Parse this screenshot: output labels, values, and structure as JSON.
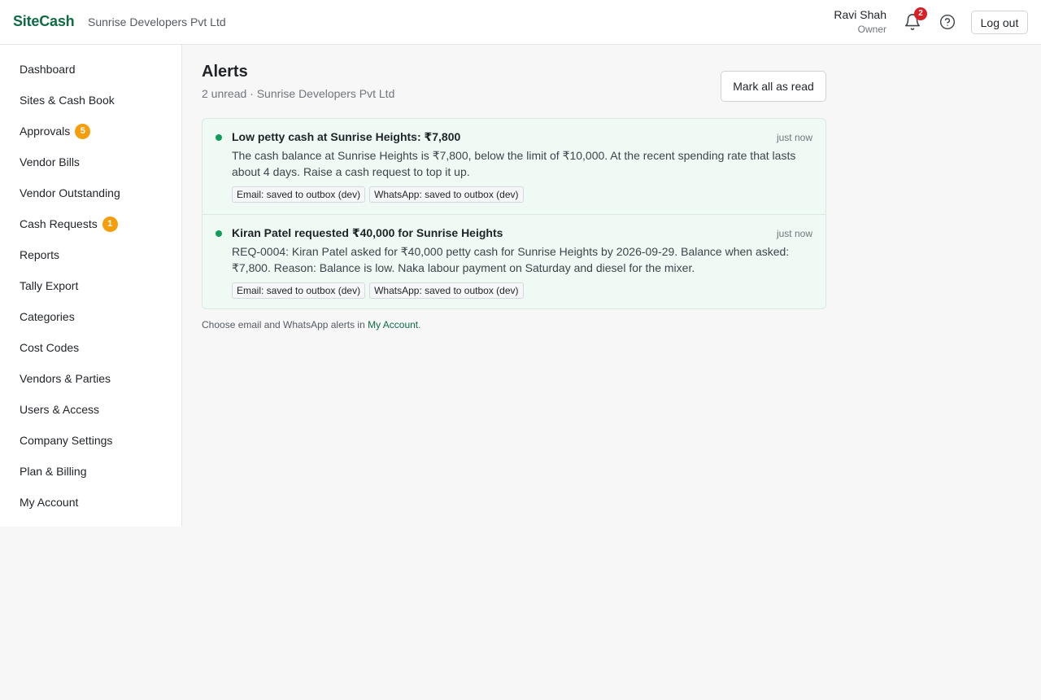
{
  "header": {
    "brand": "SiteCash",
    "company": "Sunrise Developers Pvt Ltd",
    "user_name": "Ravi Shah",
    "user_role": "Owner",
    "notification_count": "2",
    "logout_label": "Log out"
  },
  "sidebar": {
    "items": [
      {
        "label": "Dashboard",
        "badge": ""
      },
      {
        "label": "Sites & Cash Book",
        "badge": ""
      },
      {
        "label": "Approvals",
        "badge": "5"
      },
      {
        "label": "Vendor Bills",
        "badge": ""
      },
      {
        "label": "Vendor Outstanding",
        "badge": ""
      },
      {
        "label": "Cash Requests",
        "badge": "1"
      },
      {
        "label": "Reports",
        "badge": ""
      },
      {
        "label": "Tally Export",
        "badge": ""
      },
      {
        "label": "Categories",
        "badge": ""
      },
      {
        "label": "Cost Codes",
        "badge": ""
      },
      {
        "label": "Vendors & Parties",
        "badge": ""
      },
      {
        "label": "Users & Access",
        "badge": ""
      },
      {
        "label": "Company Settings",
        "badge": ""
      },
      {
        "label": "Plan & Billing",
        "badge": ""
      },
      {
        "label": "My Account",
        "badge": ""
      }
    ]
  },
  "main": {
    "title": "Alerts",
    "subtitle": "2 unread · Sunrise Developers Pvt Ltd",
    "mark_all_label": "Mark all as read",
    "alerts": [
      {
        "title": "Low petty cash at Sunrise Heights: ₹7,800",
        "time": "just now",
        "body": "The cash balance at Sunrise Heights is ₹7,800, below the limit of ₹10,000. At the recent spending rate that lasts about 4 days. Raise a cash request to top it up.",
        "chips": [
          "Email: saved to outbox (dev)",
          "WhatsApp: saved to outbox (dev)"
        ]
      },
      {
        "title": "Kiran Patel requested ₹40,000 for Sunrise Heights",
        "time": "just now",
        "body": "REQ-0004: Kiran Patel asked for ₹40,000 petty cash for Sunrise Heights by 2026-09-29. Balance when asked: ₹7,800. Reason: Balance is low. Naka labour payment on Saturday and diesel for the mixer.",
        "chips": [
          "Email: saved to outbox (dev)",
          "WhatsApp: saved to outbox (dev)"
        ]
      }
    ],
    "footnote_prefix": "Choose email and WhatsApp alerts in ",
    "footnote_link": "My Account",
    "footnote_suffix": "."
  },
  "colors": {
    "brand": "#0f6b45",
    "unread_dot": "#0f9d58",
    "badge_orange": "#f59e0b",
    "badge_red": "#d61f26",
    "alert_bg": "#eefaf3"
  }
}
